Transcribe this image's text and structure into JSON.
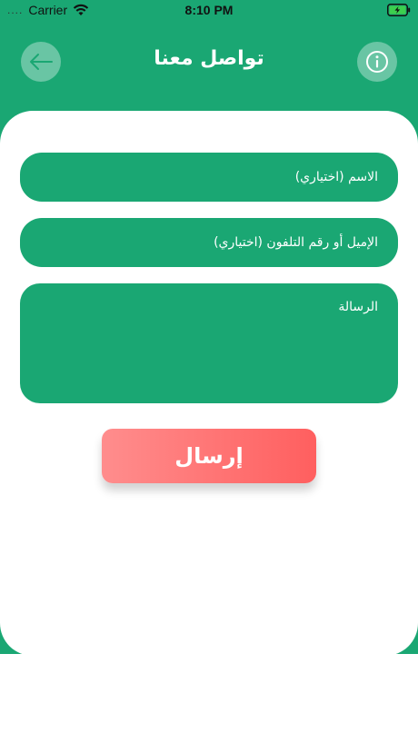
{
  "status_bar": {
    "signal": "....",
    "carrier": "Carrier",
    "time": "8:10 PM"
  },
  "header": {
    "title": "تواصل معنا",
    "back_icon": "arrow-left-icon",
    "info_icon": "info-icon"
  },
  "form": {
    "name_placeholder": "الاسم (اختياري)",
    "contact_placeholder": "الإميل أو رقم التلفون (اختياري)",
    "message_placeholder": "الرسالة",
    "submit_label": "إرسال"
  },
  "colors": {
    "primary_green": "#1aa773",
    "button_gradient_start": "#ff8d8d",
    "button_gradient_end": "#ff5f5f",
    "battery_green": "#3ccf4e"
  }
}
